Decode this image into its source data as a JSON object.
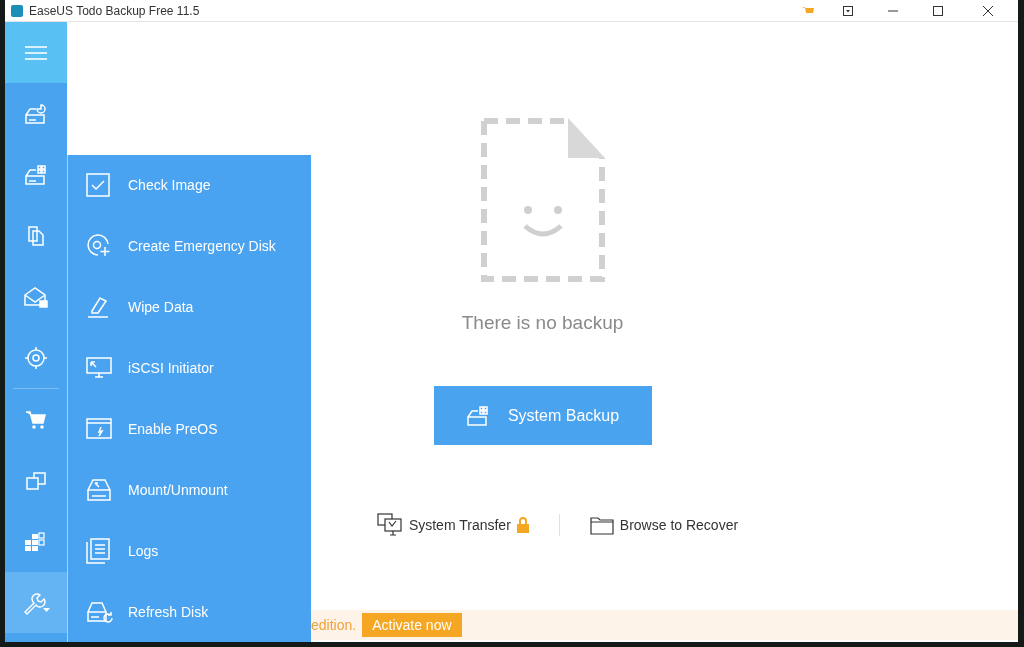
{
  "window": {
    "title": "EaseUS Todo Backup Free 11.5"
  },
  "sidebar": {
    "items": [
      {
        "selected": false
      },
      {
        "selected": false
      },
      {
        "selected": false
      },
      {
        "selected": false
      },
      {
        "selected": false
      },
      {
        "selected": false
      },
      {
        "selected": false
      },
      {
        "selected": false
      },
      {
        "selected": true
      }
    ]
  },
  "tools_menu": {
    "items": [
      {
        "label": "Check Image"
      },
      {
        "label": "Create Emergency Disk"
      },
      {
        "label": "Wipe Data"
      },
      {
        "label": "iSCSI Initiator"
      },
      {
        "label": "Enable PreOS"
      },
      {
        "label": "Mount/Unmount"
      },
      {
        "label": "Logs"
      },
      {
        "label": "Refresh Disk"
      }
    ]
  },
  "main": {
    "empty_message": "There is no backup",
    "primary_button": "System Backup",
    "links": [
      {
        "label": "System Transfer",
        "locked": true
      },
      {
        "label": "Browse to Recover",
        "locked": false
      }
    ]
  },
  "banner": {
    "text": "edition.",
    "button": "Activate now"
  }
}
